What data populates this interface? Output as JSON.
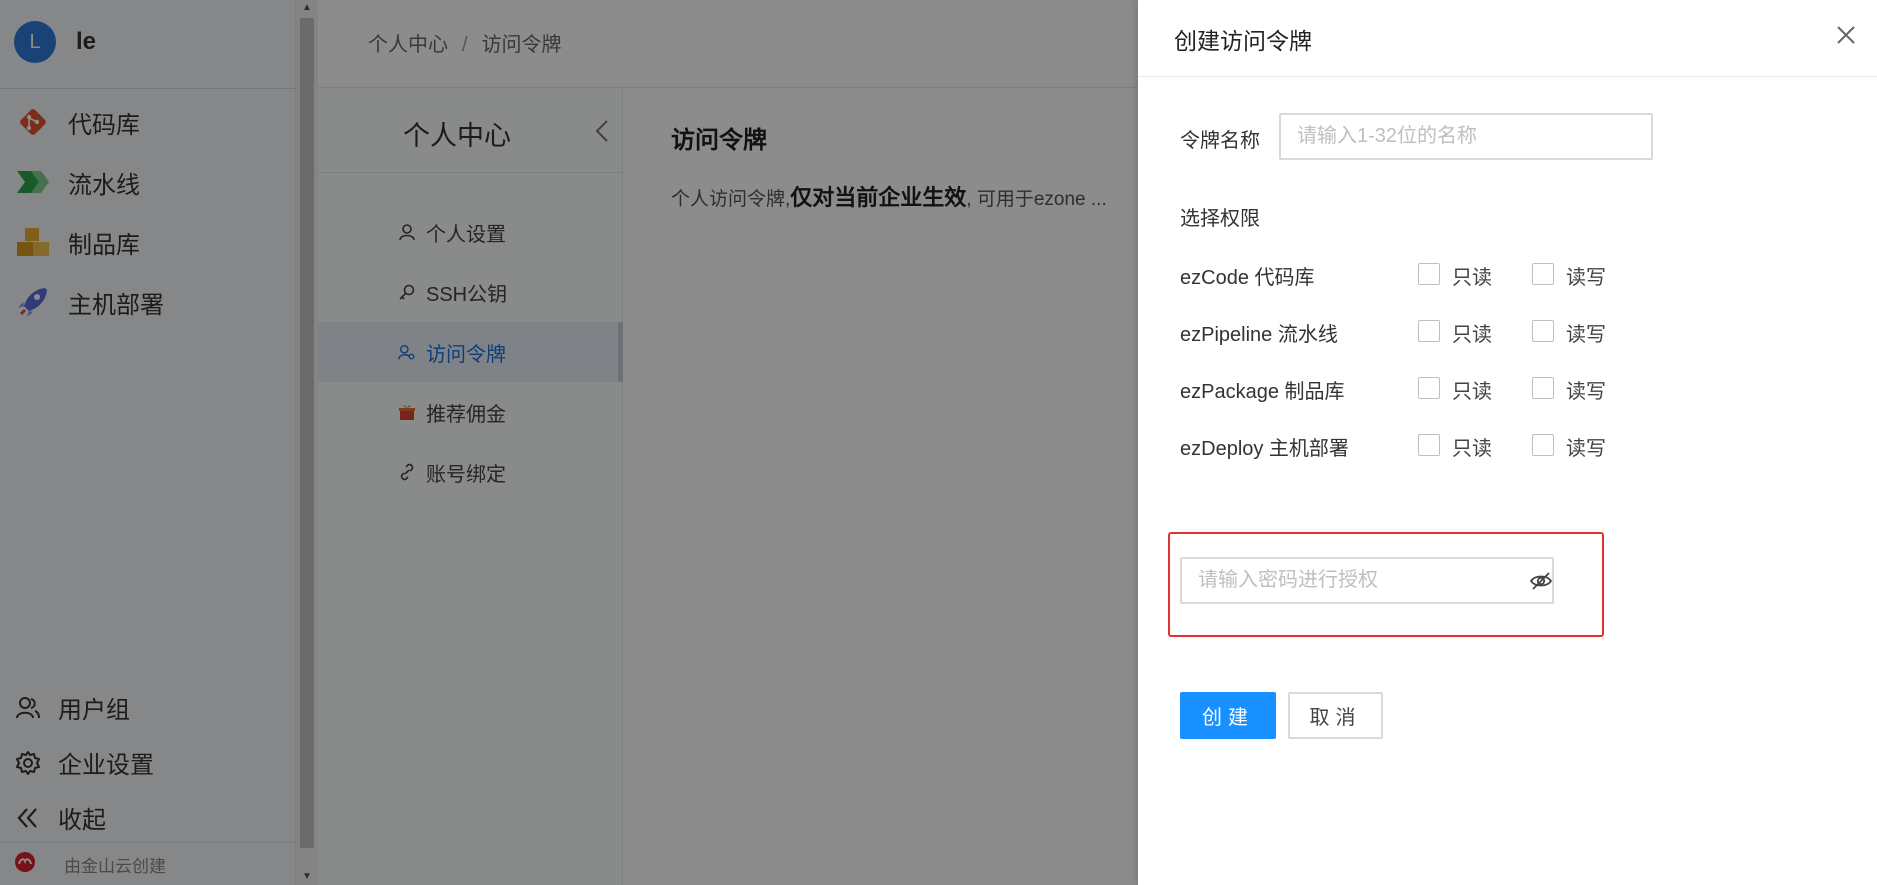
{
  "sidebar": {
    "avatar_letter": "L",
    "user_name": "le",
    "nav_items": [
      {
        "label": "代码库",
        "icon": "git-branch-icon",
        "color": "#e0542a"
      },
      {
        "label": "流水线",
        "icon": "pipeline-chevron-icon",
        "color": "#2ea44f"
      },
      {
        "label": "制品库",
        "icon": "package-boxes-icon",
        "color": "#e0a020"
      },
      {
        "label": "主机部署",
        "icon": "rocket-icon",
        "color": "#5b6cd9"
      }
    ],
    "bottom_items": [
      {
        "label": "用户组",
        "icon": "user-group-icon"
      },
      {
        "label": "企业设置",
        "icon": "gear-icon"
      },
      {
        "label": "收起",
        "icon": "double-chevron-left-icon"
      }
    ],
    "footer_credit": "由金山云创建"
  },
  "breadcrumb": {
    "root": "个人中心",
    "separator": "/",
    "current": "访问令牌"
  },
  "subnav": {
    "title": "个人中心",
    "items": [
      {
        "label": "个人设置",
        "icon": "user-icon"
      },
      {
        "label": "SSH公钥",
        "icon": "key-icon"
      },
      {
        "label": "访问令牌",
        "icon": "user-key-icon"
      },
      {
        "label": "推荐佣金",
        "icon": "gift-icon"
      },
      {
        "label": "账号绑定",
        "icon": "link-icon"
      }
    ],
    "active_index": 2
  },
  "content": {
    "title": "访问令牌",
    "desc_prefix": "个人访问令牌,",
    "desc_bold": "仅对当前企业生效",
    "desc_suffix": ", 可用于ezone ..."
  },
  "drawer": {
    "title": "创建访问令牌",
    "token_name_label": "令牌名称",
    "token_name_placeholder": "请输入1-32位的名称",
    "permissions_label": "选择权限",
    "permissions": [
      {
        "name": "ezCode 代码库",
        "readonly_label": "只读",
        "readwrite_label": "读写"
      },
      {
        "name": "ezPipeline 流水线",
        "readonly_label": "只读",
        "readwrite_label": "读写"
      },
      {
        "name": "ezPackage 制品库",
        "readonly_label": "只读",
        "readwrite_label": "读写"
      },
      {
        "name": "ezDeploy 主机部署",
        "readonly_label": "只读",
        "readwrite_label": "读写"
      }
    ],
    "password_placeholder": "请输入密码进行授权",
    "create_button": "创建",
    "cancel_button": "取消"
  },
  "colors": {
    "primary": "#1890ff",
    "highlight": "#e23232",
    "active_text": "#1d6fd8"
  }
}
